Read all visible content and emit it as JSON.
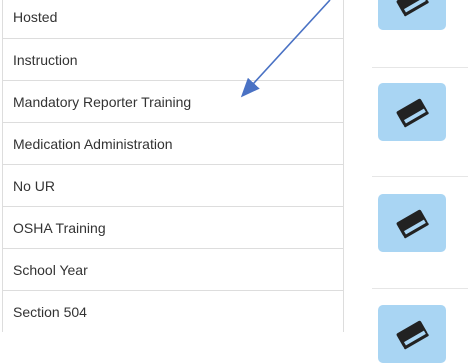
{
  "list": {
    "items": [
      {
        "label": "Hosted"
      },
      {
        "label": "Instruction"
      },
      {
        "label": "Mandatory Reporter Training"
      },
      {
        "label": "Medication Administration"
      },
      {
        "label": "No UR"
      },
      {
        "label": "OSHA Training"
      },
      {
        "label": "School Year"
      },
      {
        "label": "Section 504"
      }
    ]
  },
  "tiles": [
    {
      "icon": "book-icon"
    },
    {
      "icon": "book-icon"
    },
    {
      "icon": "book-icon"
    },
    {
      "icon": "book-icon"
    }
  ],
  "annotation": {
    "color": "#4a72c4"
  },
  "colors": {
    "tile": "#a9d5f3",
    "icon": "#222222"
  }
}
